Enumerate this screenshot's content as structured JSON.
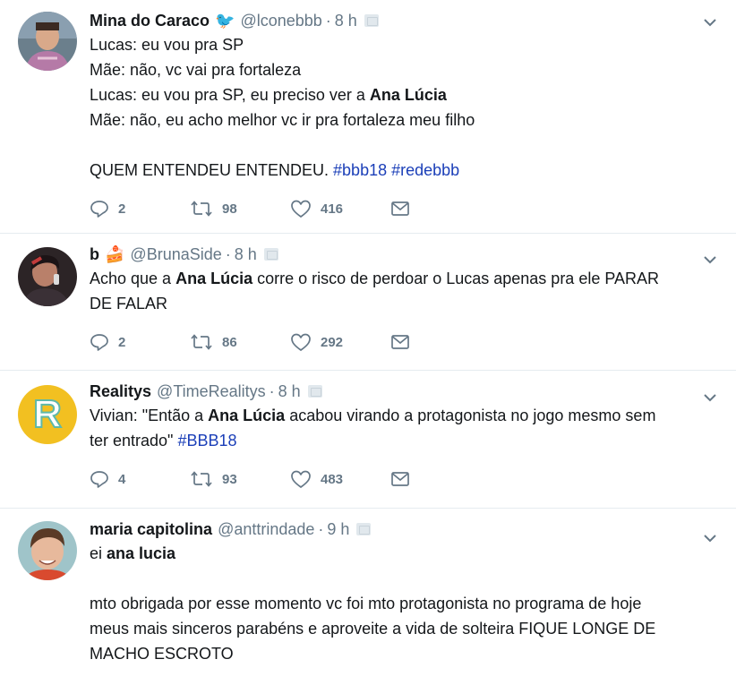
{
  "tweets": [
    {
      "name": "Mina do Caraco",
      "emoji": "🐦",
      "handle": "@lconebbb",
      "time": "8 h",
      "lines": [
        [
          {
            "t": "Lucas: eu vou pra SP"
          }
        ],
        [
          {
            "t": "Mãe: não, vc vai pra fortaleza"
          }
        ],
        [
          {
            "t": "Lucas: eu vou pra SP, eu preciso ver a "
          },
          {
            "t": "Ana Lúcia",
            "b": true
          }
        ],
        [
          {
            "t": "Mãe: não, eu acho melhor vc ir pra fortaleza meu filho"
          }
        ],
        [],
        [
          {
            "t": "QUEM ENTENDEU ENTENDEU. "
          },
          {
            "t": "#bbb18",
            "tag": true
          },
          {
            "t": " "
          },
          {
            "t": "#redebbb",
            "tag": true
          }
        ]
      ],
      "replies": "2",
      "retweets": "98",
      "likes": "416"
    },
    {
      "name": "b",
      "emoji": "🍰",
      "handle": "@BrunaSide",
      "time": "8 h",
      "lines": [
        [
          {
            "t": "Acho que a "
          },
          {
            "t": "Ana Lúcia",
            "b": true
          },
          {
            "t": " corre o risco de perdoar o Lucas apenas pra ele PARAR"
          }
        ],
        [
          {
            "t": "DE FALAR"
          }
        ]
      ],
      "replies": "2",
      "retweets": "86",
      "likes": "292"
    },
    {
      "name": "Realitys",
      "emoji": "",
      "handle": "@TimeRealitys",
      "time": "8 h",
      "lines": [
        [
          {
            "t": "Vivian: \"Então a "
          },
          {
            "t": "Ana Lúcia",
            "b": true
          },
          {
            "t": " acabou virando a protagonista no jogo mesmo sem"
          }
        ],
        [
          {
            "t": "ter entrado\" "
          },
          {
            "t": "#BBB18",
            "tag": true
          }
        ]
      ],
      "replies": "4",
      "retweets": "93",
      "likes": "483"
    },
    {
      "name": "maria capitolina",
      "emoji": "",
      "handle": "@anttrindade",
      "time": "9 h",
      "lines": [
        [
          {
            "t": "ei "
          },
          {
            "t": "ana lucia",
            "b": true
          }
        ],
        [],
        [
          {
            "t": "mto obrigada por esse momento vc foi mto protagonista no programa de hoje"
          }
        ],
        [
          {
            "t": "meus mais sinceros parabéns e aproveite a vida de solteira FIQUE LONGE DE"
          }
        ],
        [
          {
            "t": "MACHO ESCROTO"
          }
        ]
      ]
    }
  ],
  "avatar_letter_realitys": "R",
  "colors": {
    "tag": "#1b3fb8",
    "muted": "#657786",
    "divider": "#e6ecf0"
  },
  "icons": [
    "chevron-down-icon",
    "reply-icon",
    "retweet-icon",
    "like-icon",
    "dm-icon"
  ]
}
